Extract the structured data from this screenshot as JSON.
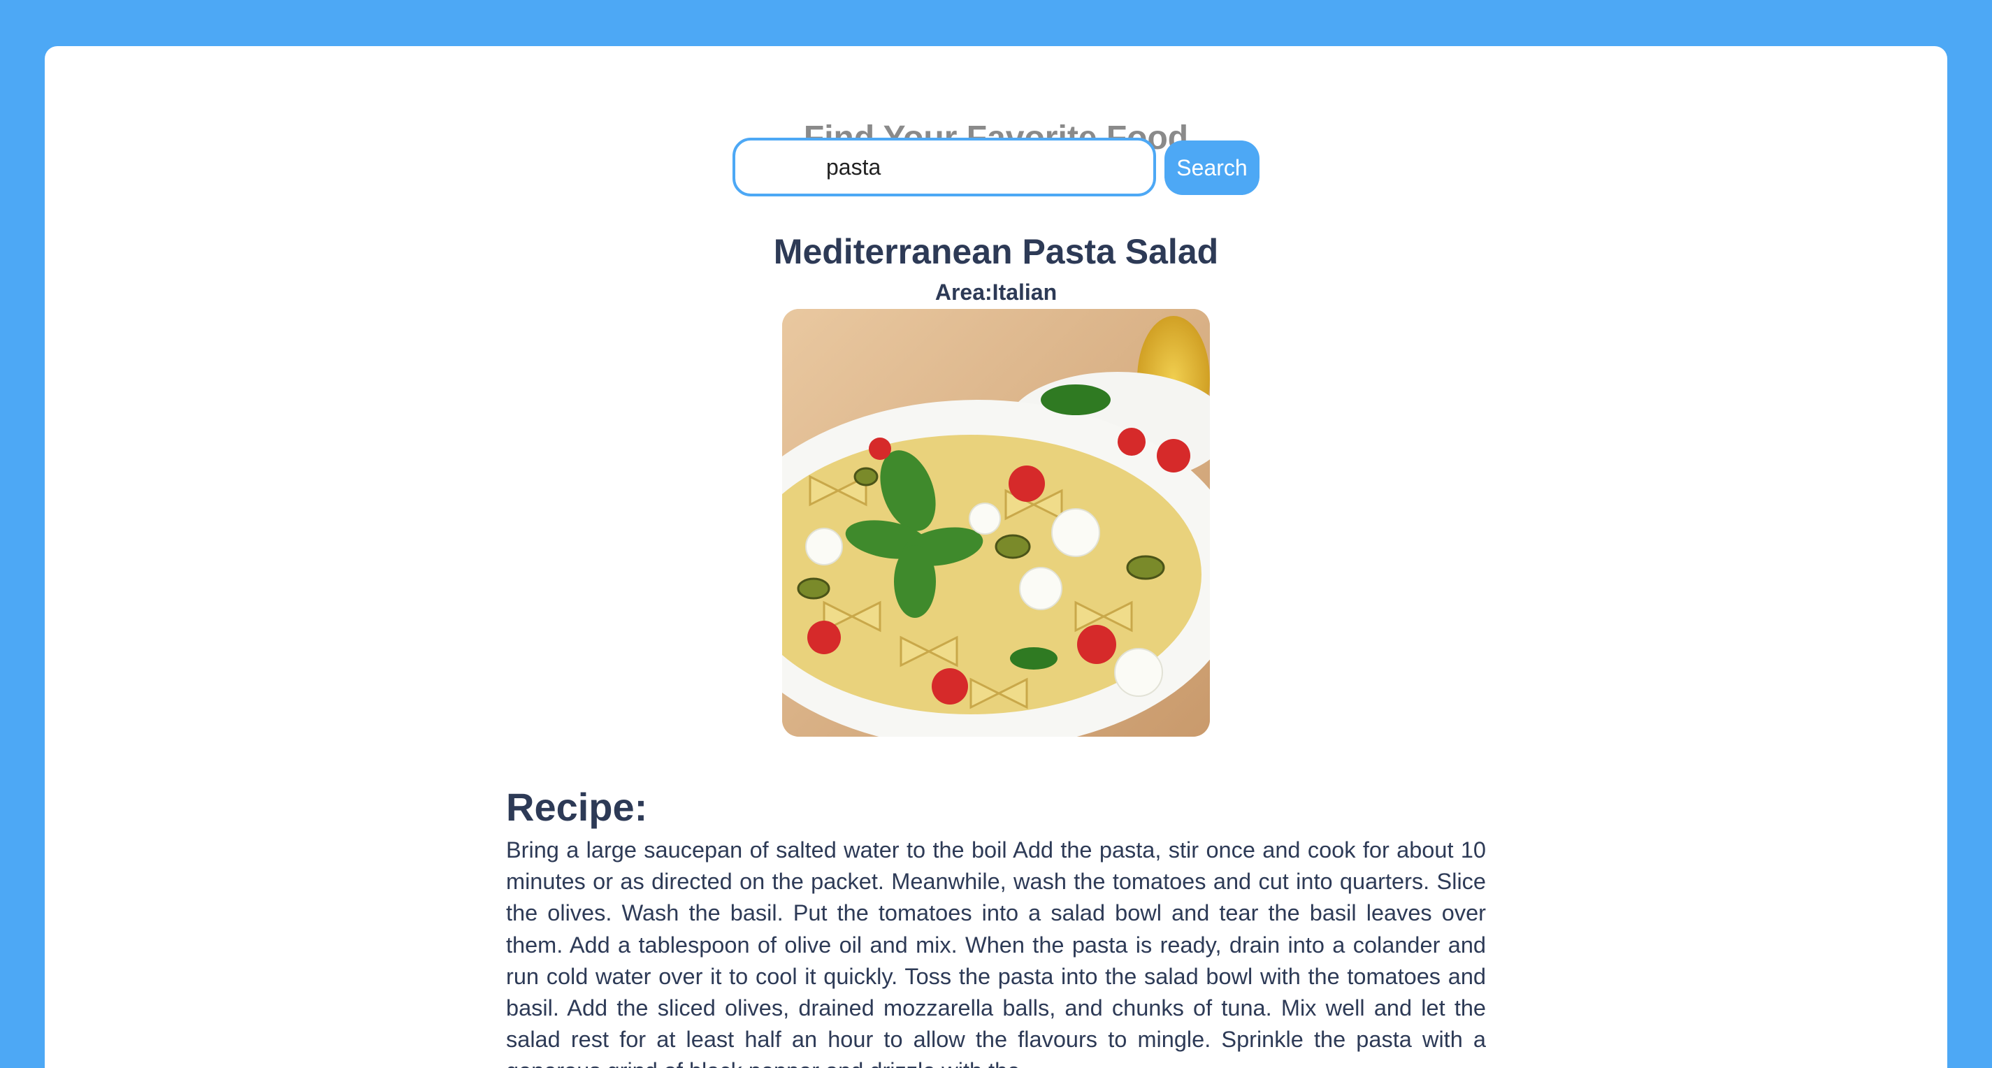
{
  "page": {
    "title": "Find Your Favorite Food"
  },
  "search": {
    "value": "pasta",
    "button_label": "Search"
  },
  "meal": {
    "name": "Mediterranean Pasta Salad",
    "area": "Area:Italian",
    "image_icon": "pasta-salad-photo"
  },
  "recipe": {
    "heading": "Recipe:",
    "text": "Bring a large saucepan of salted water to the boil Add the pasta, stir once and cook for about 10 minutes or as directed on the packet. Meanwhile, wash the tomatoes and cut into quarters. Slice the olives. Wash the basil. Put the tomatoes into a salad bowl and tear the basil leaves over them. Add a tablespoon of olive oil and mix. When the pasta is ready, drain into a colander and run cold water over it to cool it quickly. Toss the pasta into the salad bowl with the tomatoes and basil. Add the sliced olives, drained mozzarella balls, and chunks of tuna. Mix well and let the salad rest for at least half an hour to allow the flavours to mingle. Sprinkle the pasta with a generous grind of black pepper and drizzle with the"
  },
  "colors": {
    "background": "#4da8f5",
    "accent": "#4da8f5",
    "title": "#8a8a8a",
    "text": "#2d3a56"
  }
}
